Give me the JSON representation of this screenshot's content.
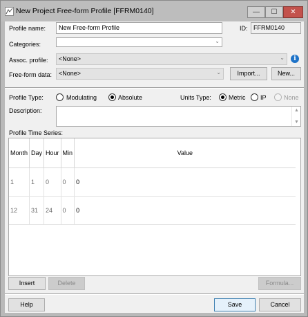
{
  "window": {
    "title": "New Project Free-form Profile [FFRM0140]",
    "buttons": {
      "minimize": "—",
      "maximize": "☐",
      "close": "✕"
    }
  },
  "form": {
    "profile_name_label": "Profile name:",
    "profile_name_value": "New Free-form Profile",
    "id_label": "ID:",
    "id_value": "FFRM0140",
    "categories_label": "Categories:",
    "categories_value": "",
    "assoc_profile_label": "Assoc. profile:",
    "assoc_profile_value": "<None>",
    "freeform_data_label": "Free-form data:",
    "freeform_data_value": "<None>",
    "import_button": "Import...",
    "new_button": "New..."
  },
  "profile_type": {
    "label": "Profile Type:",
    "options": [
      "Modulating",
      "Absolute"
    ],
    "selected": "Absolute"
  },
  "units_type": {
    "label": "Units Type:",
    "options": [
      "Metric",
      "IP",
      "None"
    ],
    "selected": "Metric"
  },
  "description": {
    "label": "Description:",
    "value": ""
  },
  "time_series": {
    "label": "Profile Time Series:",
    "columns": [
      "Month",
      "Day",
      "Hour",
      "Min",
      "Value"
    ],
    "rows": [
      [
        "1",
        "1",
        "0",
        "0",
        "0"
      ],
      [
        "12",
        "31",
        "24",
        "0",
        "0"
      ]
    ]
  },
  "actions": {
    "insert": "Insert",
    "delete": "Delete",
    "formula": "Formula...",
    "help": "Help",
    "save": "Save",
    "cancel": "Cancel"
  }
}
